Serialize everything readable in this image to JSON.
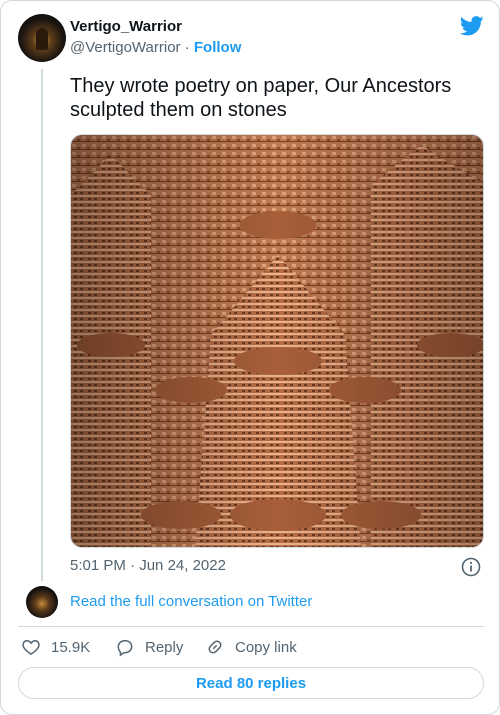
{
  "author": {
    "display_name": "Vertigo_Warrior",
    "handle": "@VertigoWarrior",
    "separator": "·",
    "follow_label": "Follow"
  },
  "tweet": {
    "text": "They wrote poetry on paper, Our Ancestors sculpted them on stones",
    "time": "5:01 PM",
    "date_separator": "·",
    "date": "Jun 24, 2022"
  },
  "conversation": {
    "read_label": "Read the full conversation on Twitter"
  },
  "actions": {
    "like_count": "15.9K",
    "reply_label": "Reply",
    "copy_link_label": "Copy link"
  },
  "replies_button": {
    "label": "Read 80 replies"
  },
  "icons": {
    "brand": "twitter-bird-icon",
    "info": "info-icon",
    "like": "heart-icon",
    "reply": "speech-bubble-icon",
    "copy": "link-icon"
  },
  "colors": {
    "accent": "#1d9bf0",
    "secondary_text": "#536471",
    "border": "#cfd9de",
    "stone": "#c98560"
  }
}
